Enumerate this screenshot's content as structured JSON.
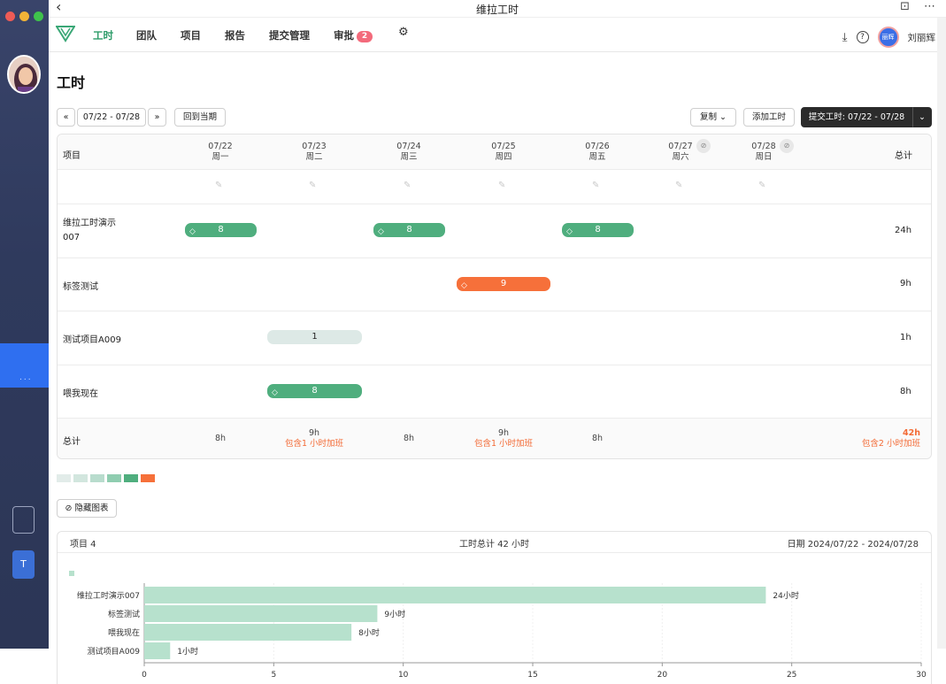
{
  "window": {
    "title": "维拉工时"
  },
  "nav": {
    "items": [
      {
        "label": "工时",
        "active": true
      },
      {
        "label": "团队"
      },
      {
        "label": "项目"
      },
      {
        "label": "报告"
      },
      {
        "label": "提交管理"
      },
      {
        "label": "审批",
        "badge": "2"
      }
    ],
    "user": {
      "name": "刘丽辉",
      "avatar_text": "丽辉"
    }
  },
  "page": {
    "title": "工时"
  },
  "toolbar": {
    "prev": "«",
    "range": "07/22 - 07/28",
    "next": "»",
    "current": "回到当期",
    "copy": "复制",
    "add": "添加工时",
    "submit": "提交工时: 07/22 - 07/28"
  },
  "table": {
    "project_header": "项目",
    "total_header": "总计",
    "days": [
      {
        "date": "07/22",
        "weekday": "周一"
      },
      {
        "date": "07/23",
        "weekday": "周二"
      },
      {
        "date": "07/24",
        "weekday": "周三"
      },
      {
        "date": "07/25",
        "weekday": "周四"
      },
      {
        "date": "07/26",
        "weekday": "周五"
      },
      {
        "date": "07/27",
        "weekday": "周六"
      },
      {
        "date": "07/28",
        "weekday": "周日"
      }
    ],
    "rows": [
      {
        "name_line1": "维拉工时演示",
        "name_line2": "007",
        "total": "24h",
        "entries": [
          {
            "day": 0,
            "value": "8",
            "style": "green",
            "tag": true
          },
          {
            "day": 2,
            "value": "8",
            "style": "green",
            "tag": true
          },
          {
            "day": 4,
            "value": "8",
            "style": "green",
            "tag": true
          }
        ]
      },
      {
        "name_line1": "标签测试",
        "total": "9h",
        "entries": [
          {
            "day": 3,
            "value": "9",
            "style": "orange",
            "tag": true
          }
        ]
      },
      {
        "name_line1": "测试项目A009",
        "total": "1h",
        "entries": [
          {
            "day": 1,
            "value": "1",
            "style": "light",
            "tag": false
          }
        ]
      },
      {
        "name_line1": "喂我现在",
        "total": "8h",
        "entries": [
          {
            "day": 1,
            "value": "8",
            "style": "green",
            "tag": true
          }
        ]
      }
    ],
    "footer": {
      "label": "总计",
      "days": [
        {
          "value": "8h"
        },
        {
          "value": "9h",
          "note": "包含1 小时加班"
        },
        {
          "value": "8h"
        },
        {
          "value": "9h",
          "note": "包含1 小时加班"
        },
        {
          "value": "8h"
        },
        {
          "value": ""
        },
        {
          "value": ""
        }
      ],
      "total": "42h",
      "total_note": "包含2 小时加班"
    }
  },
  "legend": {
    "colors": [
      "#e2ece9",
      "#d2e6de",
      "#b8dccd",
      "#8fcdb0",
      "#4fae7e",
      "#f6703a"
    ]
  },
  "hide_chart": "隐藏图表",
  "chart_panel": {
    "left": "项目 4",
    "center": "工时总计 42 小时",
    "right": "日期 2024/07/22 - 2024/07/28"
  },
  "chart_data": {
    "type": "bar",
    "orientation": "horizontal",
    "categories": [
      "维拉工时演示007",
      "标签测试",
      "喂我现在",
      "测试项目A009"
    ],
    "values": [
      24,
      9,
      8,
      1
    ],
    "value_labels": [
      "24小时",
      "9小时",
      "8小时",
      "1小时"
    ],
    "xlim": [
      0,
      30
    ],
    "xticks": [
      0,
      5,
      10,
      15,
      20,
      25,
      30
    ],
    "bar_color": "#b7e1cd",
    "grid": true
  }
}
